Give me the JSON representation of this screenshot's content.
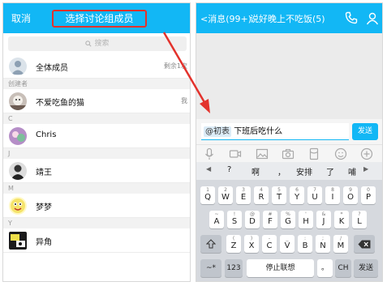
{
  "colors": {
    "accent": "#12b7f5",
    "highlight": "#e3322c"
  },
  "left": {
    "cancel": "取消",
    "title": "选择讨论组成员",
    "search_placeholder": "搜索",
    "all_members": "全体成员",
    "remaining": "剩余1次",
    "sections": {
      "creator": "创建者",
      "c": "C",
      "j": "J",
      "m": "M",
      "y": "Y"
    },
    "members": [
      {
        "name": "不爱吃鱼的猫",
        "tag": "我"
      },
      {
        "name": "Chris",
        "tag": ""
      },
      {
        "name": "靖王",
        "tag": ""
      },
      {
        "name": "梦梦",
        "tag": ""
      },
      {
        "name": "异角",
        "tag": ""
      }
    ]
  },
  "right": {
    "back": "消息(99+)",
    "title": "说好晚上不吃饭(5)",
    "mention": "@初表",
    "input_text": "下班后吃什么",
    "send": "发送",
    "candidates": [
      "?",
      "啊",
      "，",
      "安排",
      "了",
      "哺"
    ],
    "row1": [
      {
        "sub": "1",
        "ch": "Q"
      },
      {
        "sub": "2",
        "ch": "W"
      },
      {
        "sub": "3",
        "ch": "E"
      },
      {
        "sub": "4",
        "ch": "R"
      },
      {
        "sub": "5",
        "ch": "T"
      },
      {
        "sub": "6",
        "ch": "Y"
      },
      {
        "sub": "7",
        "ch": "U"
      },
      {
        "sub": "8",
        "ch": "I"
      },
      {
        "sub": "9",
        "ch": "O"
      },
      {
        "sub": "0",
        "ch": "P"
      }
    ],
    "row2": [
      {
        "sub": "~",
        "ch": "A"
      },
      {
        "sub": "!",
        "ch": "S"
      },
      {
        "sub": "@",
        "ch": "D"
      },
      {
        "sub": "#",
        "ch": "F"
      },
      {
        "sub": "%",
        "ch": "G"
      },
      {
        "sub": "'",
        "ch": "H"
      },
      {
        "sub": "&",
        "ch": "J"
      },
      {
        "sub": "*",
        "ch": "K"
      },
      {
        "sub": "?",
        "ch": "L"
      }
    ],
    "row3": [
      {
        "sub": "(",
        "ch": "Z"
      },
      {
        "sub": ")",
        "ch": "X"
      },
      {
        "sub": "-",
        "ch": "C"
      },
      {
        "sub": "_",
        "ch": "V"
      },
      {
        "sub": ":",
        "ch": "B"
      },
      {
        "sub": ";",
        "ch": "N"
      },
      {
        "sub": "/",
        "ch": "M"
      }
    ],
    "bottom": {
      "sym": "~*",
      "num": "123",
      "space": "停止联想",
      "dot": "。",
      "ch": "CH",
      "send": "发送"
    }
  }
}
